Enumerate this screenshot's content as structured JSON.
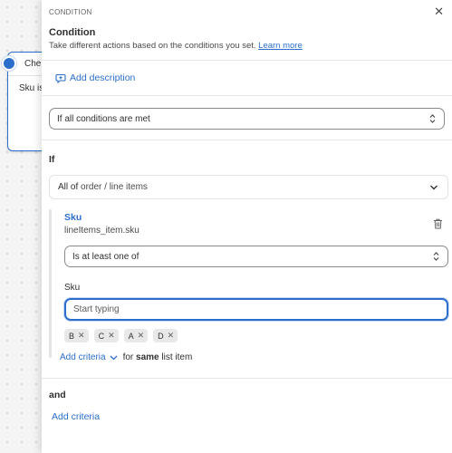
{
  "canvas": {
    "node_title": "Che",
    "node_text": "Sku is"
  },
  "panel": {
    "kicker": "CONDITION",
    "close_icon": "close-icon",
    "title": "Condition",
    "subtitle": "Take different actions based on the conditions you set.",
    "learn_more": "Learn more",
    "add_description": "Add description",
    "logic_select": "If all conditions are met",
    "if_label": "If",
    "group": {
      "prefix": "All of",
      "path": "order / line items"
    },
    "criteria": {
      "title": "Sku",
      "path": "lineItems_item.sku",
      "operator": "Is at least one of",
      "field_label": "Sku",
      "input_placeholder": "Start typing",
      "tags": [
        {
          "label": "B"
        },
        {
          "label": "C"
        },
        {
          "label": "A"
        },
        {
          "label": "D"
        }
      ],
      "add_criteria": "Add criteria",
      "for_prefix": "for",
      "for_bold": "same",
      "for_suffix": "list item"
    },
    "and_label": "and",
    "bottom_add_criteria": "Add criteria"
  },
  "colors": {
    "accent": "#2c6ecb",
    "text": "#303030",
    "tag_bg": "#e8e8e8"
  }
}
